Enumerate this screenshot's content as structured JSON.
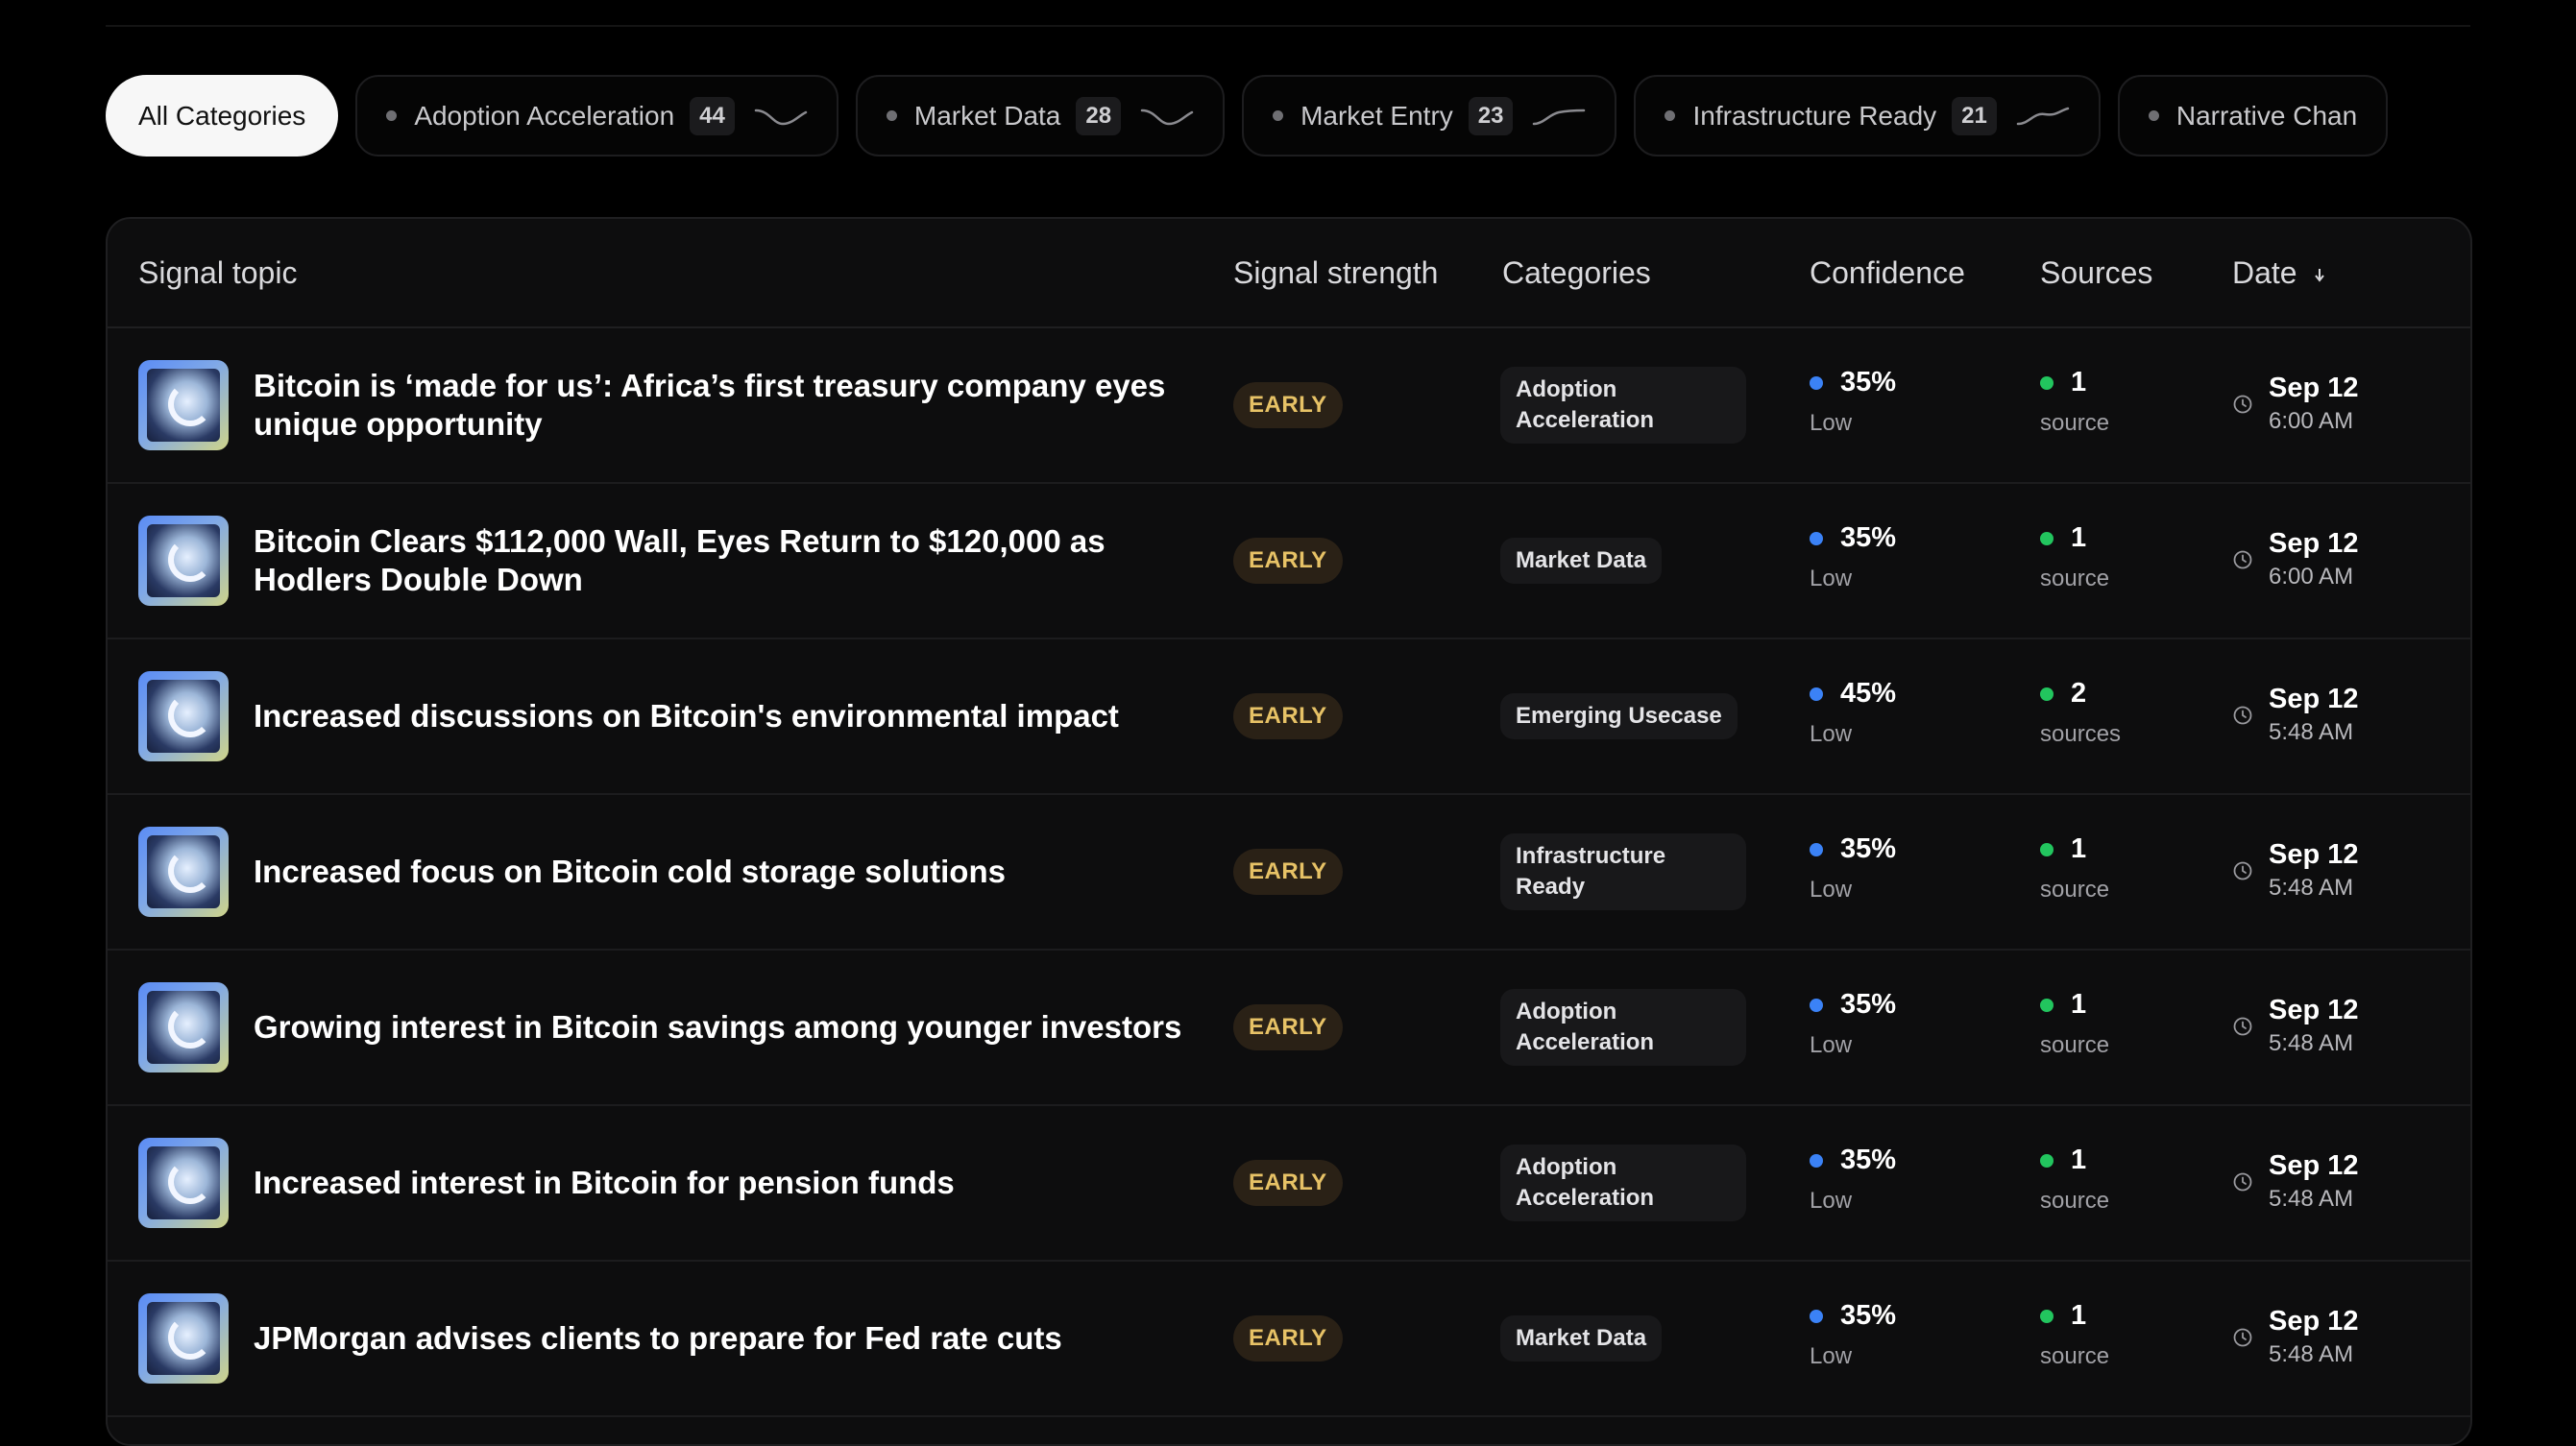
{
  "filters": [
    {
      "label": "All Categories",
      "active": true
    },
    {
      "label": "Adoption Acceleration",
      "count": "44",
      "trend": "down"
    },
    {
      "label": "Market Data",
      "count": "28",
      "trend": "down"
    },
    {
      "label": "Market Entry",
      "count": "23",
      "trend": "up"
    },
    {
      "label": "Infrastructure Ready",
      "count": "21",
      "trend": "up"
    },
    {
      "label": "Narrative Chan"
    }
  ],
  "table": {
    "headers": {
      "topic": "Signal topic",
      "strength": "Signal strength",
      "categories": "Categories",
      "confidence": "Confidence",
      "sources": "Sources",
      "date": "Date"
    },
    "rows": [
      {
        "title": "Bitcoin is ‘made for us’: Africa’s first treasury company eyes unique opportunity",
        "strength": "EARLY",
        "category": "Adoption Acceleration",
        "confidence": "35%",
        "confidence_label": "Low",
        "sources": "1",
        "sources_label": "source",
        "date": "Sep 12",
        "time": "6:00 AM"
      },
      {
        "title": "Bitcoin Clears $112,000 Wall, Eyes Return to $120,000 as Hodlers Double Down",
        "strength": "EARLY",
        "category": "Market Data",
        "confidence": "35%",
        "confidence_label": "Low",
        "sources": "1",
        "sources_label": "source",
        "date": "Sep 12",
        "time": "6:00 AM"
      },
      {
        "title": "Increased discussions on Bitcoin's environmental impact",
        "strength": "EARLY",
        "category": "Emerging Usecase",
        "confidence": "45%",
        "confidence_label": "Low",
        "sources": "2",
        "sources_label": "sources",
        "date": "Sep 12",
        "time": "5:48 AM"
      },
      {
        "title": "Increased focus on Bitcoin cold storage solutions",
        "strength": "EARLY",
        "category": "Infrastructure Ready",
        "confidence": "35%",
        "confidence_label": "Low",
        "sources": "1",
        "sources_label": "source",
        "date": "Sep 12",
        "time": "5:48 AM"
      },
      {
        "title": "Growing interest in Bitcoin savings among younger investors",
        "strength": "EARLY",
        "category": "Adoption Acceleration",
        "confidence": "35%",
        "confidence_label": "Low",
        "sources": "1",
        "sources_label": "source",
        "date": "Sep 12",
        "time": "5:48 AM"
      },
      {
        "title": "Increased interest in Bitcoin for pension funds",
        "strength": "EARLY",
        "category": "Adoption Acceleration",
        "confidence": "35%",
        "confidence_label": "Low",
        "sources": "1",
        "sources_label": "source",
        "date": "Sep 12",
        "time": "5:48 AM"
      },
      {
        "title": "JPMorgan advises clients to prepare for Fed rate cuts",
        "strength": "EARLY",
        "category": "Market Data",
        "confidence": "35%",
        "confidence_label": "Low",
        "sources": "1",
        "sources_label": "source",
        "date": "Sep 12",
        "time": "5:48 AM"
      }
    ]
  },
  "colors": {
    "background": "#000000",
    "confidence_dot": "#3b82f6",
    "sources_dot": "#22c55e",
    "early_badge": "#e7c266"
  },
  "icons": {
    "sort": "sort-arrow-icon",
    "clock": "clock-icon",
    "trend": "sparkline-icon"
  }
}
